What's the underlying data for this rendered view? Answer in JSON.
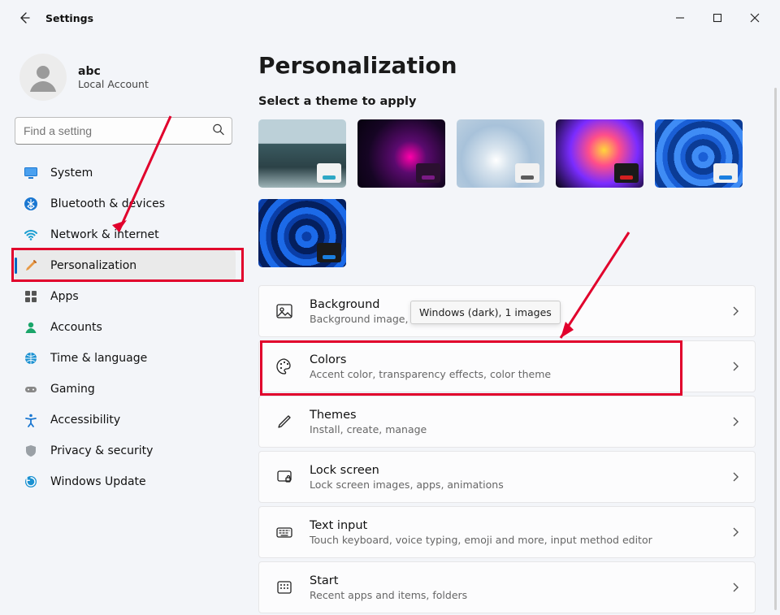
{
  "window": {
    "app_title": "Settings"
  },
  "profile": {
    "name": "abc",
    "subtitle": "Local Account"
  },
  "search": {
    "placeholder": "Find a setting"
  },
  "sidebar": {
    "items": [
      {
        "label": "System"
      },
      {
        "label": "Bluetooth & devices"
      },
      {
        "label": "Network & internet"
      },
      {
        "label": "Personalization"
      },
      {
        "label": "Apps"
      },
      {
        "label": "Accounts"
      },
      {
        "label": "Time & language"
      },
      {
        "label": "Gaming"
      },
      {
        "label": "Accessibility"
      },
      {
        "label": "Privacy & security"
      },
      {
        "label": "Windows Update"
      }
    ],
    "selected_index": 3
  },
  "main": {
    "heading": "Personalization",
    "themes_heading": "Select a theme to apply",
    "tooltip": "Windows (dark), 1 images",
    "cards": [
      {
        "title": "Background",
        "desc": "Background image, color"
      },
      {
        "title": "Colors",
        "desc": "Accent color, transparency effects, color theme"
      },
      {
        "title": "Themes",
        "desc": "Install, create, manage"
      },
      {
        "title": "Lock screen",
        "desc": "Lock screen images, apps, animations"
      },
      {
        "title": "Text input",
        "desc": "Touch keyboard, voice typing, emoji and more, input method editor"
      },
      {
        "title": "Start",
        "desc": "Recent apps and items, folders"
      }
    ]
  }
}
